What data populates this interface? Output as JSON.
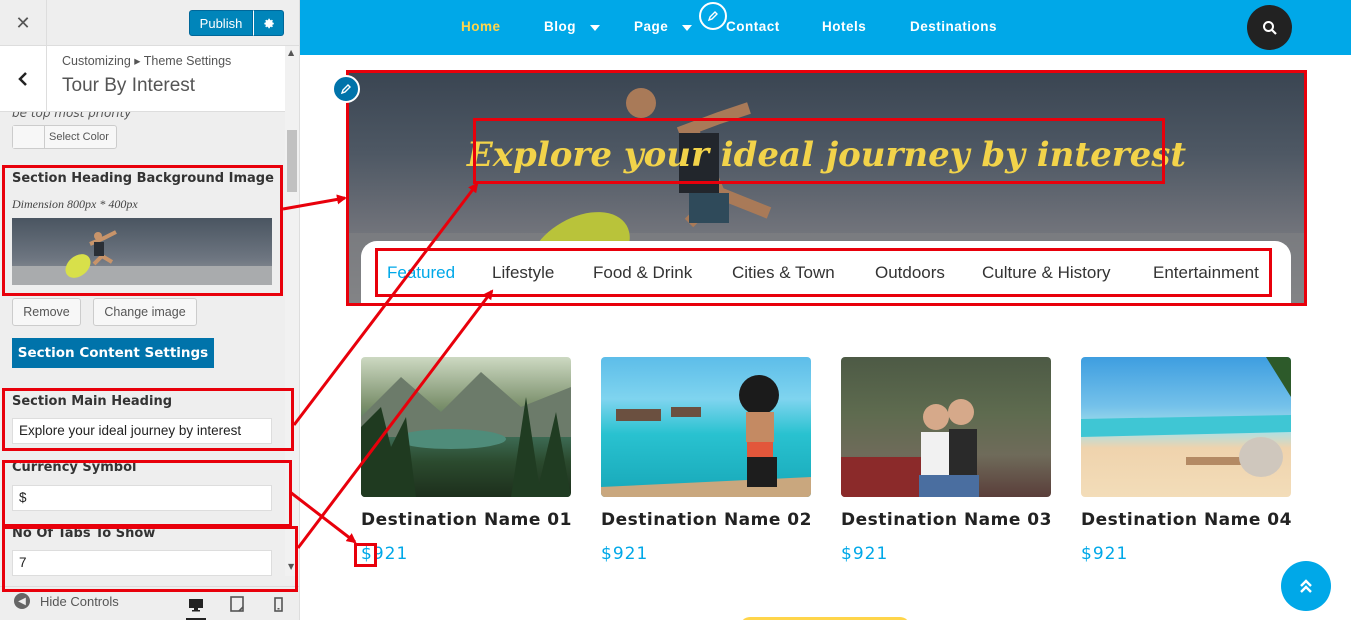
{
  "customizer": {
    "close_icon": "close-icon",
    "publish_label": "Publish",
    "settings_icon": "gear-icon",
    "breadcrumb": "Customizing ▸ Theme Settings",
    "section_title": "Tour By Interest",
    "priority_text": "be top most priority",
    "select_color_label": "Select Color",
    "bg_image_label": "Section Heading Background Image",
    "bg_image_desc": "Dimension 800px * 400px",
    "remove_label": "Remove",
    "change_image_label": "Change image",
    "content_settings_label": "Section Content Settings",
    "main_heading_label": "Section Main Heading",
    "main_heading_value": "Explore your ideal journey by interest",
    "currency_label": "Currency Symbol",
    "currency_value": "$",
    "tabs_count_label": "No Of Tabs To Show",
    "tabs_count_value": "7",
    "hide_controls_label": "Hide Controls"
  },
  "nav": {
    "items": [
      {
        "label": "Home",
        "active": true
      },
      {
        "label": "Blog",
        "has_dropdown": true
      },
      {
        "label": "Page",
        "has_dropdown": true
      },
      {
        "label": "Contact"
      },
      {
        "label": "Hotels"
      },
      {
        "label": "Destinations"
      }
    ],
    "search_icon": "search-icon"
  },
  "hero": {
    "title": "Explore your ideal journey by interest",
    "tabs": [
      "Featured",
      "Lifestyle",
      "Food & Drink",
      "Cities & Town",
      "Outdoors",
      "Culture & History",
      "Entertainment"
    ],
    "active_tab": "Featured"
  },
  "destinations": [
    {
      "name": "Destination Name 01",
      "price": "$921"
    },
    {
      "name": "Destination Name 02",
      "price": "$921"
    },
    {
      "name": "Destination Name 03",
      "price": "$921"
    },
    {
      "name": "Destination Name 04",
      "price": "$921"
    }
  ],
  "colors": {
    "nav_bg": "#00a8e8",
    "nav_active": "#ffd54a",
    "hero_title": "#f2d34a",
    "annotation": "#e8000b",
    "wp_primary": "#0085ba"
  }
}
